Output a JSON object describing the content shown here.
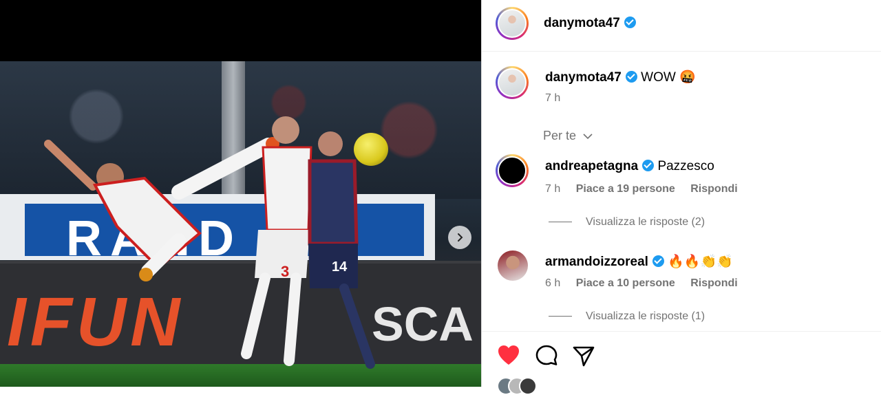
{
  "post": {
    "author": "danymota47",
    "caption": "WOW 🤬",
    "caption_time": "7 h"
  },
  "sort_label": "Per te",
  "comments": [
    {
      "username": "andreapetagna",
      "text": "Pazzesco",
      "time": "7 h",
      "likes": "Piace a 19 persone",
      "reply": "Rispondi",
      "view_replies": "Visualizza le risposte (2)"
    },
    {
      "username": "armandoizzoreal",
      "text": "🔥🔥👏👏",
      "time": "6 h",
      "likes": "Piace a 10 persone",
      "reply": "Rispondi",
      "view_replies": "Visualizza le risposte (1)"
    }
  ],
  "photo": {
    "board_left": "RAND",
    "board_fun": "IFUN",
    "board_scal": "SCA",
    "jersey_white": "3",
    "jersey_dark": "14"
  },
  "colors": {
    "like_red": "#ff3040",
    "verified_blue": "#1d9bf0",
    "muted": "#737373"
  },
  "icons": [
    "heart-icon",
    "comment-icon",
    "share-icon",
    "verified-icon",
    "chevron-down-icon",
    "chevron-right-icon"
  ]
}
